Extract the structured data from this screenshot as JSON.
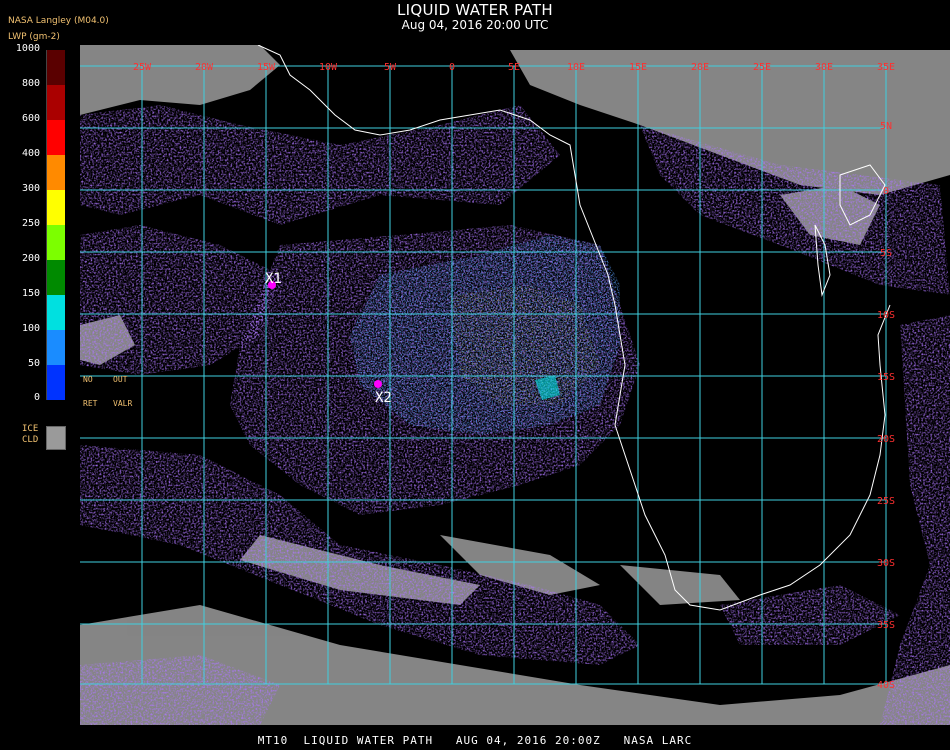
{
  "header": {
    "title": "LIQUID WATER PATH",
    "subtitle": "Aug 04, 2016 20:00 UTC",
    "source": "NASA Langley (M04.0)",
    "unit": "LWP (gm-2)"
  },
  "legend": {
    "ticks": [
      "1000",
      "800",
      "600",
      "400",
      "300",
      "250",
      "200",
      "150",
      "100",
      "50",
      "0"
    ],
    "colors": [
      "#5a0000",
      "#aa0000",
      "#ff0000",
      "#ff8a00",
      "#ffff00",
      "#7cff00",
      "#008a00",
      "#00e0e0",
      "#1a8cff",
      "#0033ff",
      "#7a30ff"
    ],
    "flags": [
      "NO",
      "OUT",
      "RET",
      "VALR"
    ],
    "ice_label_1": "ICE",
    "ice_label_2": "CLD",
    "ice_color": "#9a9a9a"
  },
  "map": {
    "lon_labels": [
      "25W",
      "20W",
      "15W",
      "10W",
      "5W",
      "0",
      "5E",
      "10E",
      "15E",
      "20E",
      "25E",
      "30E",
      "35E"
    ],
    "lat_labels": [
      "0",
      "5S",
      "10S",
      "15S",
      "20S",
      "25S",
      "30S",
      "35S",
      "40S"
    ],
    "lat_labels_top": [
      "5N"
    ],
    "markers": [
      {
        "label": "X1",
        "color": "#ff00ff"
      },
      {
        "label": "X2",
        "color": "#ff00ff"
      }
    ],
    "grid_color": "#40d0e0",
    "coast_color": "#ffffff",
    "label_color": "#ff3030"
  },
  "footer": {
    "text": "MT10  LIQUID WATER PATH   AUG 04, 2016 20:00Z   NASA LARC"
  }
}
